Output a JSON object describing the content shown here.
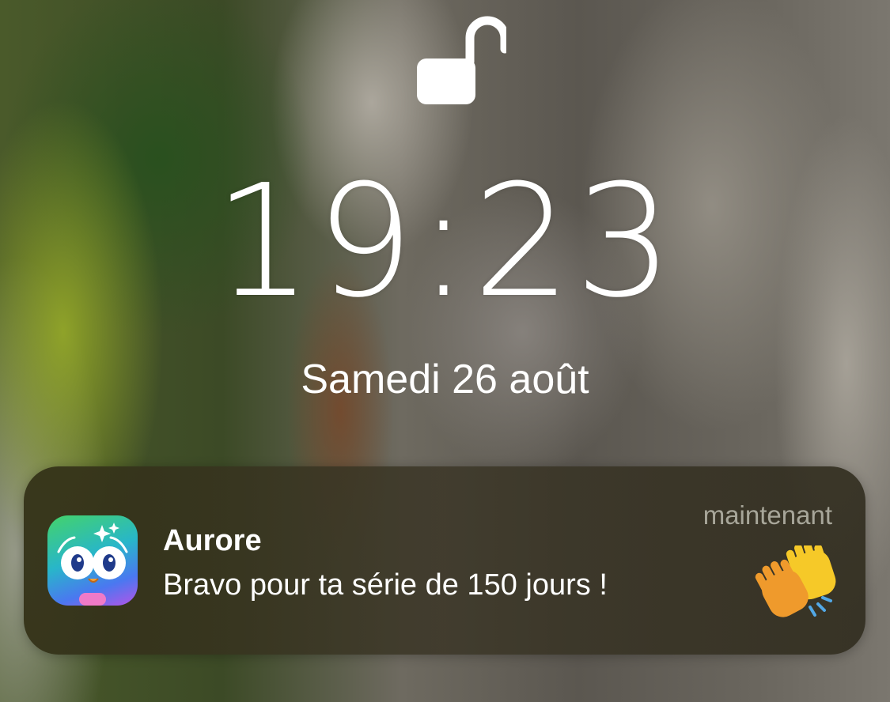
{
  "lockscreen": {
    "lock_state": "unlocked",
    "time": "19:23",
    "date": "Samedi 26 août"
  },
  "notification": {
    "app_name": "Aurore",
    "message": "Bravo pour ta série de 150 jours !",
    "timestamp": "maintenant",
    "app_icon": "owl-mascot-icon",
    "attachment_icon": "clapping-hands-emoji"
  },
  "colors": {
    "text": "#ffffff",
    "timestamp": "#b9b6a6",
    "notification_bg": "#33301a"
  }
}
